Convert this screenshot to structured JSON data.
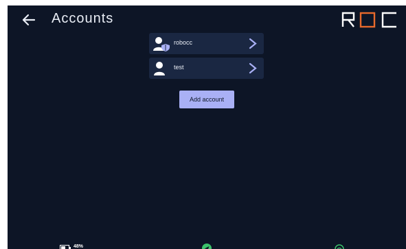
{
  "header": {
    "title": "Accounts",
    "logo_text": "ROC",
    "icons": {
      "back": "arrow-left-icon"
    }
  },
  "accounts": [
    {
      "name": "robocc",
      "icon": "user-shield-icon"
    },
    {
      "name": "test",
      "icon": "user-icon"
    }
  ],
  "actions": {
    "add_account_label": "Add account"
  },
  "status_bar": {
    "battery_text": "48%",
    "icons": [
      "battery-icon",
      "send-icon",
      "wifi-icon"
    ]
  },
  "colors": {
    "background": "#0d1526",
    "row_background": "#1a2742",
    "accent": "#a9b0f5",
    "logo_accent": "#e8692c",
    "status_green": "#3cc36b"
  }
}
